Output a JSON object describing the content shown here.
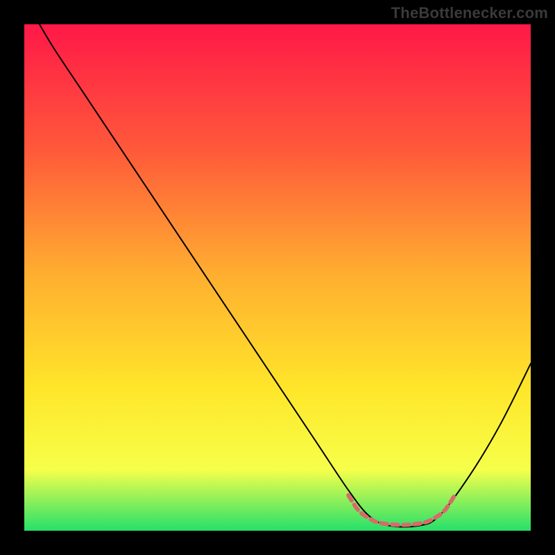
{
  "watermark": "TheBottlenecker.com",
  "chart_data": {
    "type": "line",
    "title": "",
    "xlabel": "",
    "ylabel": "",
    "xlim": [
      0,
      100
    ],
    "ylim": [
      0,
      100
    ],
    "background_gradient": {
      "stops": [
        {
          "offset": 0,
          "color": "#ff1848"
        },
        {
          "offset": 25,
          "color": "#ff5a3a"
        },
        {
          "offset": 50,
          "color": "#ffb030"
        },
        {
          "offset": 72,
          "color": "#ffe62a"
        },
        {
          "offset": 88,
          "color": "#f6ff4a"
        },
        {
          "offset": 100,
          "color": "#25e06a"
        }
      ]
    },
    "series": [
      {
        "name": "bottleneck-curve",
        "color": "#000000",
        "width": 2,
        "points": [
          {
            "x": 3,
            "y": 100
          },
          {
            "x": 6,
            "y": 95
          },
          {
            "x": 12,
            "y": 86
          },
          {
            "x": 20,
            "y": 74
          },
          {
            "x": 30,
            "y": 59
          },
          {
            "x": 40,
            "y": 44
          },
          {
            "x": 50,
            "y": 29
          },
          {
            "x": 58,
            "y": 17
          },
          {
            "x": 64,
            "y": 8
          },
          {
            "x": 68,
            "y": 3
          },
          {
            "x": 72,
            "y": 1
          },
          {
            "x": 78,
            "y": 1
          },
          {
            "x": 82,
            "y": 3
          },
          {
            "x": 88,
            "y": 11
          },
          {
            "x": 94,
            "y": 21
          },
          {
            "x": 100,
            "y": 33
          }
        ]
      },
      {
        "name": "optimal-band",
        "color": "#d86a6a",
        "width": 6,
        "points": [
          {
            "x": 64,
            "y": 7
          },
          {
            "x": 66,
            "y": 4
          },
          {
            "x": 68,
            "y": 2.5
          },
          {
            "x": 70,
            "y": 1.6
          },
          {
            "x": 73,
            "y": 1.2
          },
          {
            "x": 76,
            "y": 1.2
          },
          {
            "x": 79,
            "y": 1.6
          },
          {
            "x": 81,
            "y": 2.5
          },
          {
            "x": 83,
            "y": 4
          },
          {
            "x": 85,
            "y": 7
          }
        ]
      }
    ]
  }
}
